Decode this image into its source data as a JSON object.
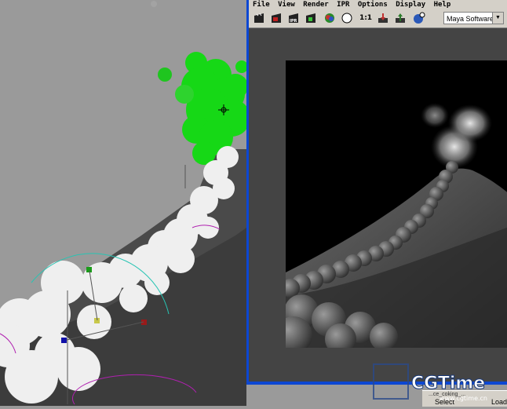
{
  "render_window": {
    "menu": [
      "File",
      "View",
      "Render",
      "IPR",
      "Options",
      "Display",
      "Help"
    ],
    "toolbar": {
      "ipr_label": "IPR",
      "ratio_label": "1:1",
      "renderer": "Maya Software"
    }
  },
  "watermark": {
    "brand": "CGTime",
    "url": "www.cgtime.cn"
  },
  "bottom_panel": {
    "field_text": "...ce_coking_...",
    "select_label": "Select",
    "load_label": "Load"
  },
  "colors": {
    "render_window_border": "#0c47d3",
    "particles_selected": "#11e011",
    "viewport_background": "#9a9a9a"
  }
}
